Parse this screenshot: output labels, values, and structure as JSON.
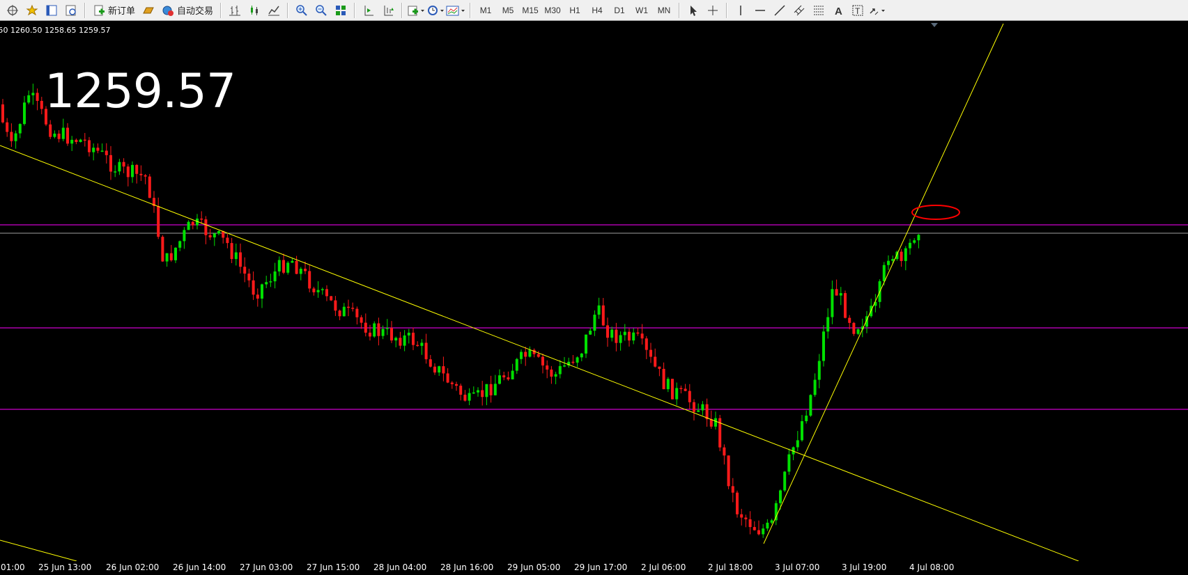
{
  "toolbar": {
    "new_order_label": "新订单",
    "auto_trade_label": "自动交易",
    "timeframes": [
      "M1",
      "M5",
      "M15",
      "M30",
      "H1",
      "H4",
      "D1",
      "W1",
      "MN"
    ]
  },
  "chart_header": {
    "ohlc_text": ".50 1260.50 1258.65 1259.57",
    "current_price": "1259.57"
  },
  "time_axis": {
    "labels": [
      "01:00",
      "25 Jun 13:00",
      "26 Jun 02:00",
      "26 Jun 14:00",
      "27 Jun 03:00",
      "27 Jun 15:00",
      "28 Jun 04:00",
      "28 Jun 16:00",
      "29 Jun 05:00",
      "29 Jun 17:00",
      "2 Jul 06:00",
      "2 Jul 18:00",
      "3 Jul 07:00",
      "3 Jul 19:00",
      "4 Jul 08:00"
    ]
  },
  "colors": {
    "background": "#000000",
    "bull_candle": "#00e000",
    "bear_candle": "#ff1a1a",
    "trend_line": "#ffff00",
    "level_line": "#ff00ff",
    "bid_line": "#a0a0a0",
    "highlight_ellipse": "#ff0000"
  }
}
